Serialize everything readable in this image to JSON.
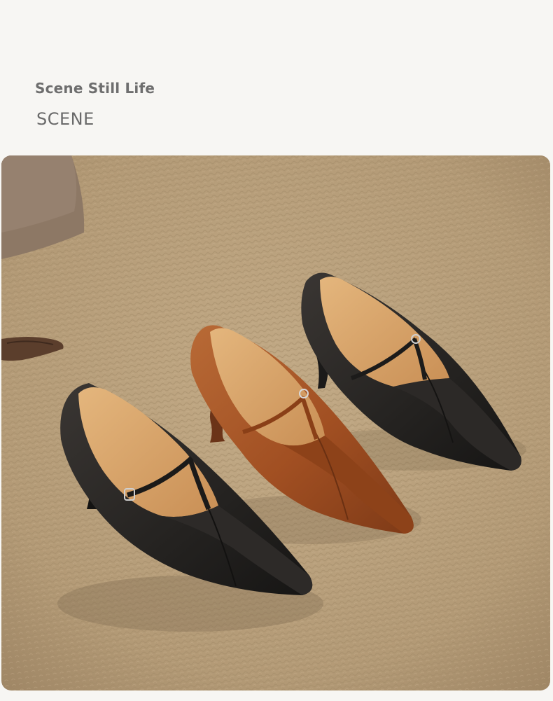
{
  "section": {
    "title": "Scene Still Life",
    "subtitle": "SCENE"
  },
  "photo": {
    "subject": "three pointed-toe T-strap kitten-heel pumps on woven jute mat",
    "colors": {
      "background_jute": "#b79f7c",
      "shoe_black": "#262422",
      "shoe_tan": "#a9582a",
      "lining": "#d9a66b",
      "prop_stone": "#8b7562",
      "prop_wood": "#5a3d2b"
    }
  }
}
